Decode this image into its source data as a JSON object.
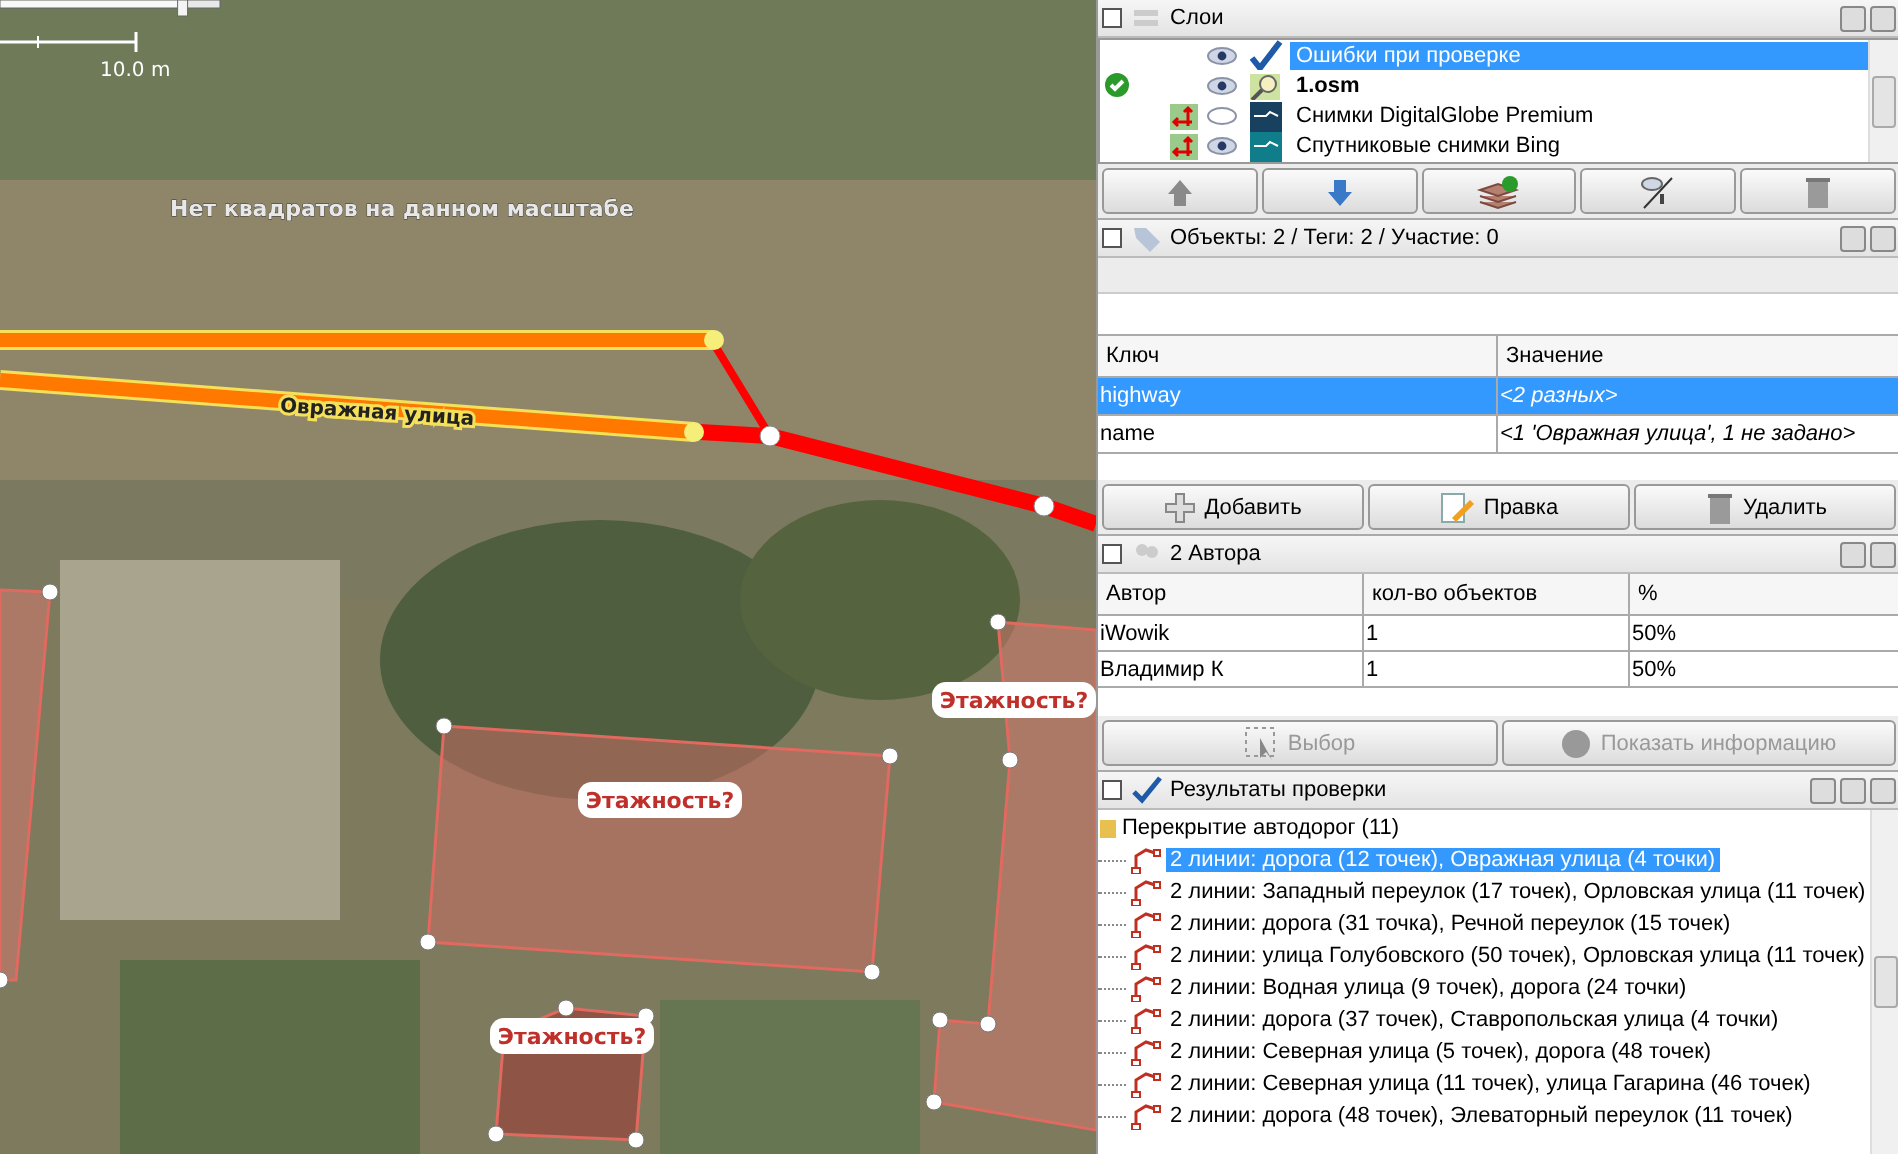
{
  "map": {
    "zoom": {
      "level": 0.83
    },
    "scale_label": "10.0 m",
    "message": "Нет квадратов на данном масштабе",
    "street_label": "Овражная улица",
    "building_labels": [
      "Этажность?",
      "Этажность?",
      "Этажность?"
    ]
  },
  "layers": {
    "title": "Слои",
    "items": [
      {
        "name": "Ошибки при проверке",
        "kind": "validation",
        "selected": true,
        "visible": true,
        "active": false
      },
      {
        "name": "1.osm",
        "kind": "data",
        "selected": false,
        "visible": true,
        "active": true
      },
      {
        "name": "Снимки DigitalGlobe Premium",
        "kind": "imagery",
        "selected": false,
        "visible": false,
        "active": false
      },
      {
        "name": "Спутниковые снимки Bing",
        "kind": "imagery",
        "selected": false,
        "visible": true,
        "active": false
      }
    ]
  },
  "tags": {
    "title": "Объекты: 2 / Теги: 2 / Участие: 0",
    "columns": [
      "Ключ",
      "Значение"
    ],
    "rows": [
      {
        "key": "highway",
        "value": "<2 разных>",
        "selected": true
      },
      {
        "key": "name",
        "value": "<1 'Овражная улица', 1 не задано>",
        "selected": false
      }
    ],
    "buttons": [
      {
        "label": "Добавить",
        "kind": "add"
      },
      {
        "label": "Правка",
        "kind": "edit"
      },
      {
        "label": "Удалить",
        "kind": "delete"
      }
    ]
  },
  "authors": {
    "title": "2 Автора",
    "columns": [
      "Автор",
      "кол-во объектов",
      "%"
    ],
    "rows": [
      [
        "iWowik",
        "1",
        "50%"
      ],
      [
        "Владимир К",
        "1",
        "50%"
      ]
    ],
    "buttons": [
      {
        "label": "Выбор",
        "kind": "select",
        "disabled": true
      },
      {
        "label": "Показать информацию",
        "kind": "info",
        "disabled": true
      }
    ]
  },
  "validation": {
    "title": "Результаты проверки",
    "groups": [
      {
        "label": "Перекрытие автодорог (11)",
        "expanded": true,
        "children": [
          {
            "label": "2 линии: дорога (12 точек), Овражная улица (4 точки)",
            "selected": true
          },
          {
            "label": "2 линии: Западный переулок (17 точек), Орловская улица (11 точек)",
            "selected": false
          },
          {
            "label": "2 линии: дорога (31 точка), Речной переулок (15 точек)",
            "selected": false
          },
          {
            "label": "2 линии: улица Голубовского (50 точек), Орловская улица (11 точек)",
            "selected": false
          },
          {
            "label": "2 линии: Водная улица (9 точек), дорога (24 точки)",
            "selected": false
          },
          {
            "label": "2 линии: дорога (37 точек), Ставропольская улица (4 точки)",
            "selected": false
          },
          {
            "label": "2 линии: Северная улица (5 точек), дорога (48 точек)",
            "selected": false
          },
          {
            "label": "2 линии: Северная улица (11 точек), улица Гагарина (46 точек)",
            "selected": false
          },
          {
            "label": "2 линии: дорога (48 точек), Элеваторный переулок (11 точек)",
            "selected": false
          }
        ]
      }
    ]
  }
}
